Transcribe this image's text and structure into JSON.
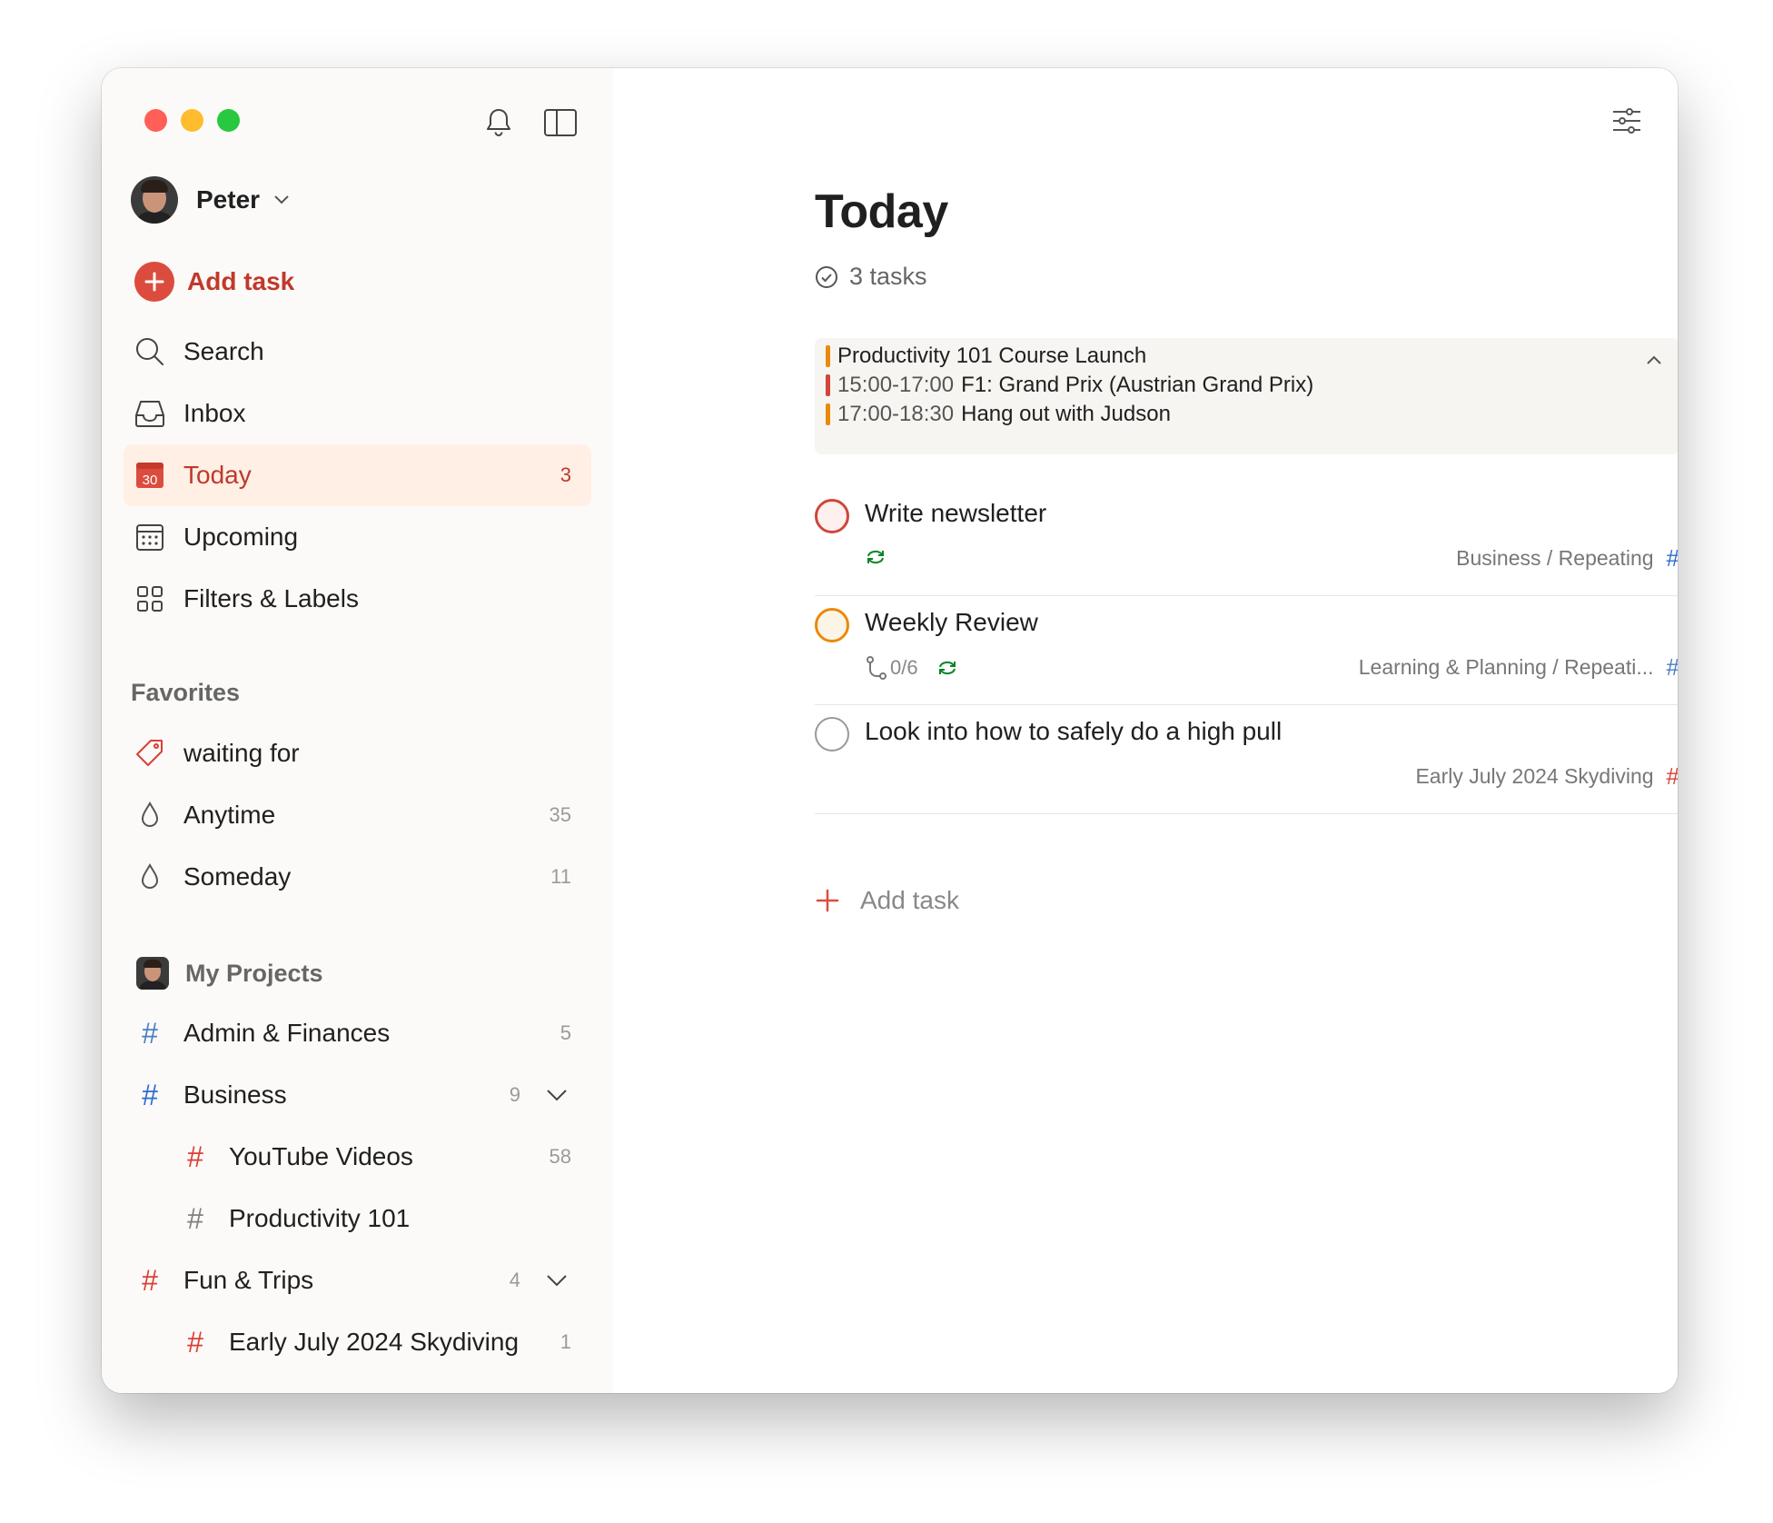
{
  "colors": {
    "accent": "#dc4c3e",
    "accent_text": "#c0392b",
    "today_bg": "#ffefe5",
    "sidebar_bg": "#fcfaf8",
    "blue_project": "#4073ff",
    "red_project": "#db4035",
    "grey_project": "#808080",
    "priority1": "#d1453b",
    "priority2": "#eb8909",
    "recurring": "#058527"
  },
  "sidebar": {
    "user": {
      "name": "Peter"
    },
    "add_task_label": "Add task",
    "nav": [
      {
        "label": "Search",
        "icon": "search-icon"
      },
      {
        "label": "Inbox",
        "icon": "inbox-icon"
      },
      {
        "label": "Today",
        "icon": "calendar-today-icon",
        "icon_text": "30",
        "count": "3",
        "active": true
      },
      {
        "label": "Upcoming",
        "icon": "calendar-grid-icon"
      },
      {
        "label": "Filters & Labels",
        "icon": "grid-icon"
      }
    ],
    "favorites_title": "Favorites",
    "favorites": [
      {
        "label": "waiting for",
        "icon": "tag-icon"
      },
      {
        "label": "Anytime",
        "icon": "drop-icon",
        "count": "35"
      },
      {
        "label": "Someday",
        "icon": "drop-icon",
        "count": "11"
      }
    ],
    "projects_title": "My Projects",
    "projects": [
      {
        "label": "Admin & Finances",
        "count": "5",
        "hash_color": "#4a7ec4"
      },
      {
        "label": "Business",
        "count": "9",
        "hash_color": "#2f6cd0",
        "expanded": true
      },
      {
        "label": "YouTube Videos",
        "count": "58",
        "hash_color": "#db4035",
        "child": true
      },
      {
        "label": "Productivity 101",
        "count": "",
        "hash_color": "#808080",
        "child": true
      },
      {
        "label": "Fun & Trips",
        "count": "4",
        "hash_color": "#db4035",
        "expanded": true
      },
      {
        "label": "Early July 2024 Skydiving",
        "count": "1",
        "hash_color": "#db4035",
        "child": true
      }
    ]
  },
  "main": {
    "title": "Today",
    "task_count": "3 tasks",
    "events": [
      {
        "time": "",
        "title": "Productivity 101 Course Launch",
        "color": "#eb8909"
      },
      {
        "time": "15:00-17:00",
        "title": "F1: Grand Prix (Austrian Grand Prix)",
        "color": "#d1453b"
      },
      {
        "time": "17:00-18:30",
        "title": "Hang out with Judson",
        "color": "#eb8909"
      }
    ],
    "tasks": [
      {
        "title": "Write newsletter",
        "subtasks": "",
        "recurring": true,
        "project": "Business / Repeating",
        "hash_color": "#2f6cd0",
        "priority_color": "#d1453b"
      },
      {
        "title": "Weekly Review",
        "subtasks": "0/6",
        "recurring": true,
        "project": "Learning & Planning / Repeati...",
        "hash_color": "#4a7ec4",
        "priority_color": "#eb8909"
      },
      {
        "title": "Look into how to safely do a high pull",
        "subtasks": "",
        "recurring": false,
        "project": "Early July 2024 Skydiving",
        "hash_color": "#db4035",
        "priority_color": "#999999"
      }
    ],
    "add_task_label": "Add task"
  }
}
